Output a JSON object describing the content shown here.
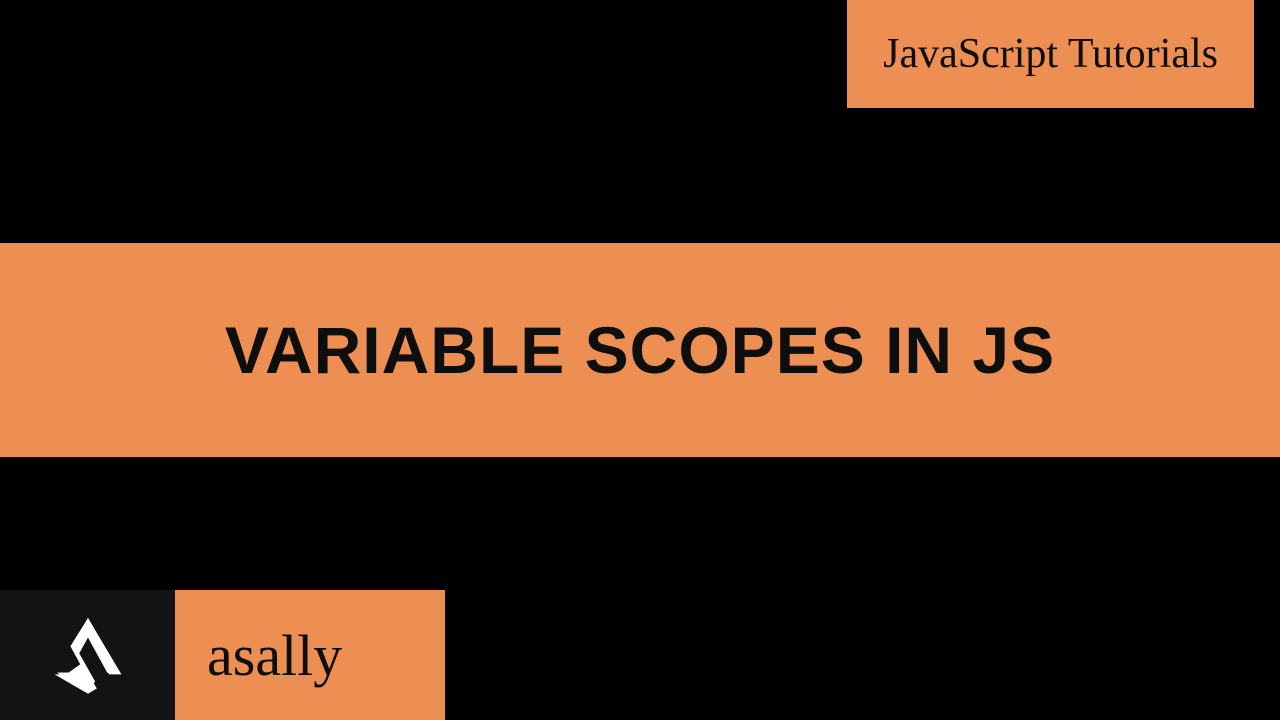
{
  "header": {
    "category": "JavaScript Tutorials"
  },
  "main": {
    "title": "VARIABLE SCOPES IN JS"
  },
  "footer": {
    "brand": "asally"
  },
  "colors": {
    "accent": "#ed8e52",
    "background": "#000000",
    "text": "#0e0e0e"
  }
}
